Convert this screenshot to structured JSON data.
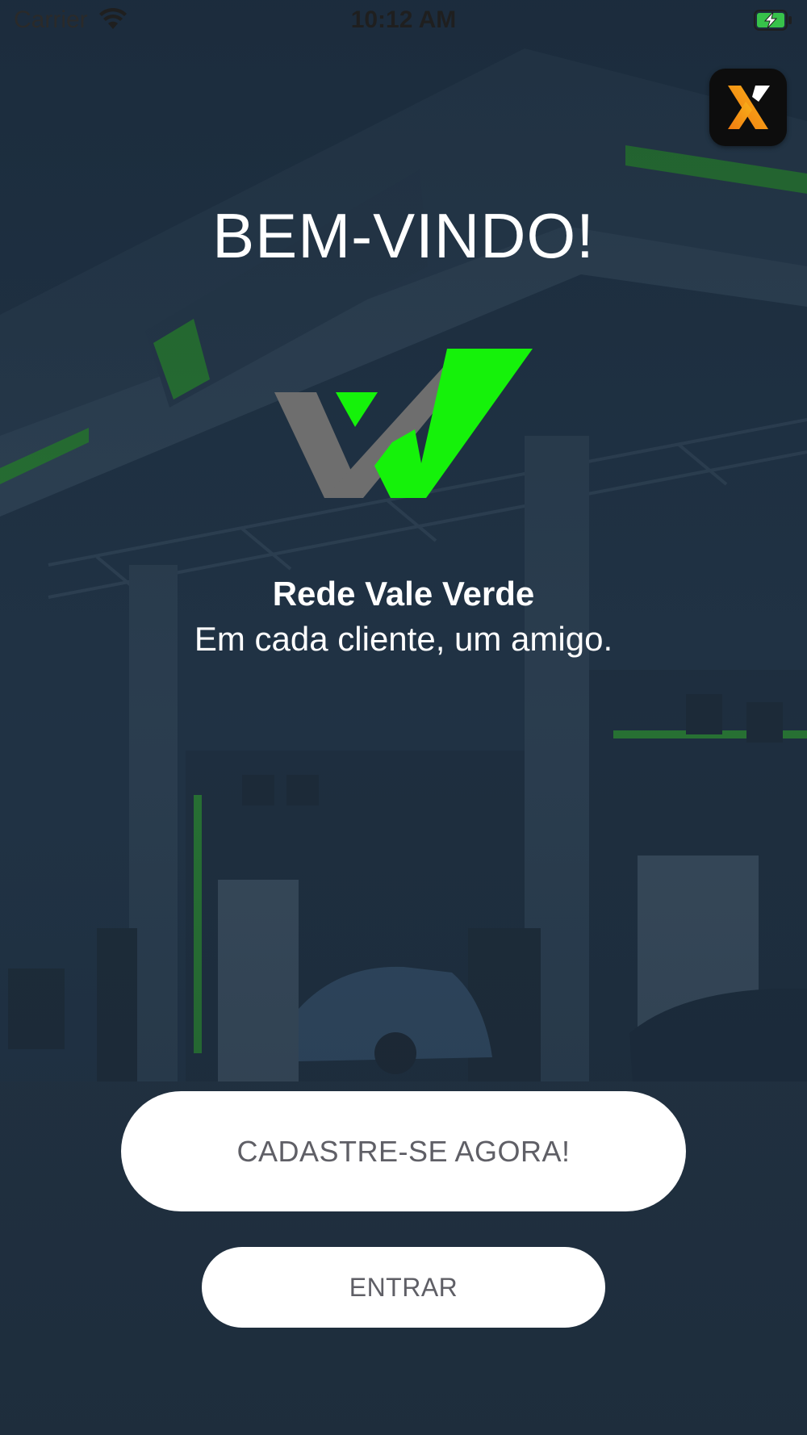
{
  "status_bar": {
    "carrier": "Carrier",
    "time": "10:12 AM",
    "wifi_icon": "wifi-icon",
    "battery_icon": "battery-charging-icon"
  },
  "app_badge": {
    "icon": "x-logo-icon",
    "colors": {
      "background": "#0d0d0d",
      "accent": "#f08a12"
    }
  },
  "welcome": {
    "title": "BEM-VINDO!"
  },
  "logo": {
    "icon": "vale-verde-logo-icon",
    "colors": {
      "gray": "#6e6e6e",
      "green": "#15f20a"
    }
  },
  "brand": {
    "name": "Rede Vale Verde",
    "tagline": "Em cada cliente, um amigo."
  },
  "actions": {
    "signup_label": "CADASTRE-SE AGORA!",
    "login_label": "ENTRAR"
  },
  "theme": {
    "background": "#1c2b3a",
    "button_bg": "#ffffff",
    "button_text": "#5f5f66"
  }
}
